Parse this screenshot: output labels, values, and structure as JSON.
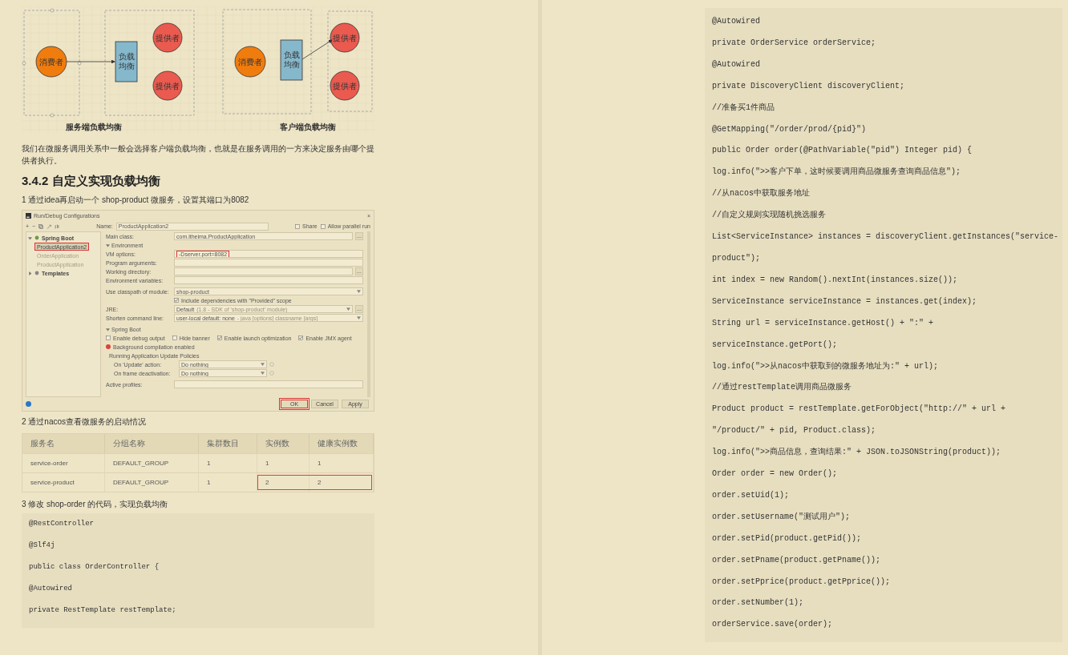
{
  "left_page": {
    "diagram": {
      "panels": [
        {
          "kind": "server",
          "caption": "服务端负载均衡",
          "consumer": "消费者",
          "balancer": [
            "负载",
            "均衡"
          ],
          "providers": [
            "提供者",
            "提供者"
          ]
        },
        {
          "kind": "client",
          "caption": "客户端负载均衡",
          "consumer": "消费者",
          "balancer": [
            "负载",
            "均衡"
          ],
          "providers": [
            "提供者",
            "提供者"
          ]
        }
      ]
    },
    "paragraph": "我们在微服务调用关系中一般会选择客户端负载均衡，也就是在服务调用的一方来决定服务由哪个提供者执行。",
    "heading": "3.4.2 自定义实现负载均衡",
    "step_1": "1 通过idea再启动一个 shop-product 微服务，设置其端口为8082",
    "ide_dialog": {
      "title": "Run/Debug Configurations",
      "close": "×",
      "toolbar": [
        "+",
        "−"
      ],
      "name_label": "Name:",
      "name_value": "ProductApplication2",
      "options": [
        {
          "label": "Share",
          "checked": false
        },
        {
          "label": "Allow parallel run",
          "checked": false
        }
      ],
      "tree": [
        {
          "label": "Spring Boot",
          "expanded": true,
          "children": [
            {
              "label": "ProductApplication2",
              "selected": true,
              "marked": true
            },
            {
              "label": "OrderApplication",
              "selected": false,
              "marked": false
            },
            {
              "label": "ProductApplication",
              "selected": false,
              "marked": false
            }
          ]
        },
        {
          "label": "Templates",
          "expanded": false
        }
      ],
      "main_class": {
        "label": "Main class:",
        "value": "com.itheima.ProductApplication",
        "browse": "..."
      },
      "environment": {
        "title": "Environment",
        "expanded": true,
        "fields": [
          {
            "label": "VM options:",
            "value": "-Dserver.port=8082",
            "marked": true
          },
          {
            "label": "Program arguments:",
            "marked": false
          },
          {
            "label": "Working directory:",
            "marked": false,
            "browse": "..."
          },
          {
            "label": "Environment variables:",
            "marked": false
          }
        ]
      },
      "classpath": {
        "label": "Use classpath of module:",
        "value": "shop-product"
      },
      "include_provided": {
        "label": "Include dependencies with \"Provided\" scope",
        "checked": true
      },
      "jre": {
        "label": "JRE:",
        "value": "Default",
        "hint": "(1.8 - SDK of 'shop-product' module)",
        "browse": "..."
      },
      "shorten": {
        "label": "Shorten command line:",
        "value": "user-local default: none",
        "hint": "- java [options] classname [args]"
      },
      "spring_boot": {
        "title": "Spring Boot",
        "expanded": true,
        "checks": [
          {
            "label": "Enable debug output",
            "checked": false
          },
          {
            "label": "Hide banner",
            "checked": false
          },
          {
            "label": "Enable launch optimization",
            "checked": true
          },
          {
            "label": "Enable JMX agent",
            "checked": true
          }
        ],
        "notice": "Background compilation enabled",
        "policies_title": "Running Application Update Policies",
        "policies": [
          {
            "label": "On 'Update' action:",
            "value": "Do nothing"
          },
          {
            "label": "On frame deactivation:",
            "value": "Do nothing"
          }
        ]
      },
      "active_profiles": {
        "label": "Active profiles:"
      },
      "buttons": [
        {
          "label": "OK",
          "marked": true
        },
        {
          "label": "Cancel",
          "marked": false
        },
        {
          "label": "Apply",
          "marked": false
        }
      ]
    },
    "step_2": "2 通过nacos查看微服务的启动情况",
    "table": {
      "columns": [
        "服务名",
        "分组名称",
        "集群数目",
        "实例数",
        "健康实例数"
      ],
      "rows": [
        {
          "cells": [
            "service-order",
            "DEFAULT_GROUP",
            "1",
            "1",
            "1"
          ],
          "highlight": false
        },
        {
          "cells": [
            "service-product",
            "DEFAULT_GROUP",
            "1",
            "2",
            "2"
          ],
          "highlight": true
        }
      ]
    },
    "step_3": "3 修改 shop-order 的代码，实现负载均衡",
    "code": [
      "@RestController",
      "@Slf4j",
      "public class OrderController {",
      "@Autowired",
      "private RestTemplate restTemplate;"
    ]
  },
  "right_page": {
    "code": [
      "@Autowired",
      "private OrderService orderService;",
      "@Autowired",
      "private DiscoveryClient discoveryClient;",
      "//准备买1件商品",
      "@GetMapping(\"/order/prod/{pid}\")",
      "public Order order(@PathVariable(\"pid\") Integer pid) {",
      "log.info(\">>客户下单，这时候要调用商品微服务查询商品信息\");",
      "//从nacos中获取服务地址",
      "//自定义规则实现随机挑选服务",
      "List<ServiceInstance> instances = discoveryClient.getInstances(\"service-",
      "product\");",
      "int index = new Random().nextInt(instances.size());",
      "ServiceInstance serviceInstance = instances.get(index);",
      "String url = serviceInstance.getHost() + \":\" +",
      "serviceInstance.getPort();",
      "log.info(\">>从nacos中获取到的微服务地址为:\" + url);",
      "//通过restTemplate调用商品微服务",
      "Product product = restTemplate.getForObject(\"http://\" + url +",
      "\"/product/\" + pid, Product.class);",
      "log.info(\">>商品信息，查询结果:\" + JSON.toJSONString(product));",
      "Order order = new Order();",
      "order.setUid(1);",
      "order.setUsername(\"测试用户\");",
      "order.setPid(product.getPid());",
      "order.setPname(product.getPname());",
      "order.setPprice(product.getPprice());",
      "order.setNumber(1);",
      "orderService.save(order);"
    ]
  }
}
